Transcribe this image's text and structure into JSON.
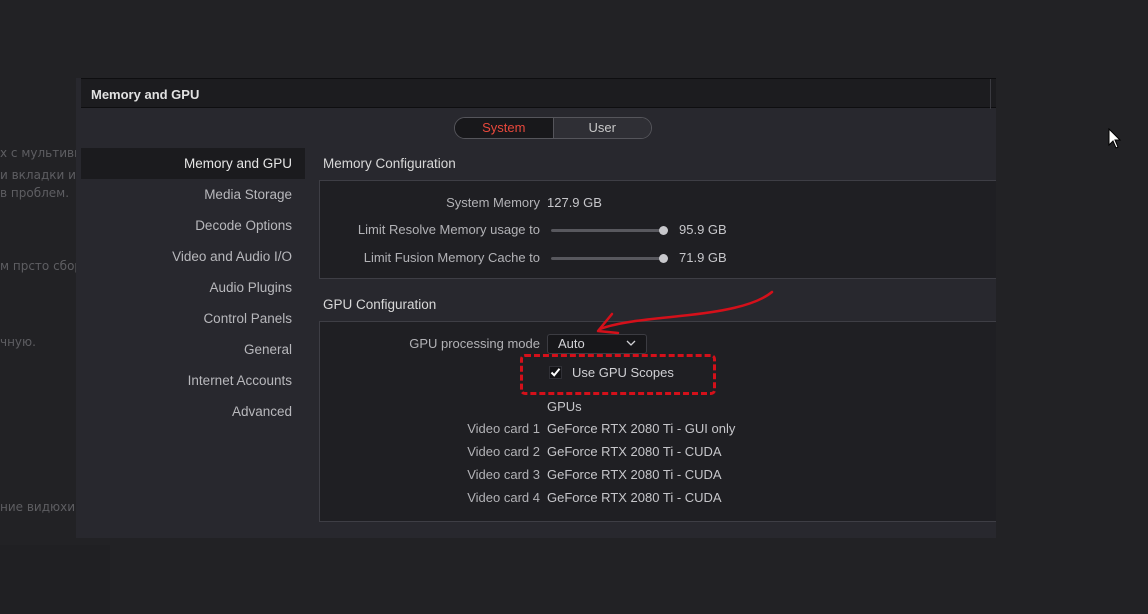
{
  "background": {
    "snippets": [
      "х с мультивк",
      "и вкладки и",
      "в проблем.",
      "м прсто сбор",
      "чную.",
      "ние видюхи д"
    ]
  },
  "dialog": {
    "title": "Memory and GPU",
    "tabs": [
      {
        "label": "System",
        "active": true
      },
      {
        "label": "User",
        "active": false
      }
    ]
  },
  "sidebar": {
    "items": [
      {
        "label": "Memory and GPU",
        "active": true
      },
      {
        "label": "Media Storage"
      },
      {
        "label": "Decode Options"
      },
      {
        "label": "Video and Audio I/O"
      },
      {
        "label": "Audio Plugins"
      },
      {
        "label": "Control Panels"
      },
      {
        "label": "General"
      },
      {
        "label": "Internet Accounts"
      },
      {
        "label": "Advanced"
      }
    ]
  },
  "memory": {
    "section_title": "Memory Configuration",
    "system_memory_label": "System Memory",
    "system_memory_value": "127.9 GB",
    "limit_resolve_label": "Limit Resolve Memory usage to",
    "limit_resolve_value": "95.9 GB",
    "limit_resolve_fraction": 1.0,
    "limit_fusion_label": "Limit Fusion Memory Cache to",
    "limit_fusion_value": "71.9 GB",
    "limit_fusion_fraction": 1.0
  },
  "gpu": {
    "section_title": "GPU Configuration",
    "processing_mode_label": "GPU processing mode",
    "processing_mode_value": "Auto",
    "use_gpu_scopes_label": "Use GPU Scopes",
    "use_gpu_scopes_checked": true,
    "gpus_heading": "GPUs",
    "cards": [
      {
        "label": "Video card 1",
        "value": "GeForce RTX 2080 Ti - GUI only"
      },
      {
        "label": "Video card 2",
        "value": "GeForce RTX 2080 Ti - CUDA"
      },
      {
        "label": "Video card 3",
        "value": "GeForce RTX 2080 Ti - CUDA"
      },
      {
        "label": "Video card 4",
        "value": "GeForce RTX 2080 Ti - CUDA"
      }
    ]
  },
  "colors": {
    "accent_active_tab": "#e8483c",
    "annotation_red": "#d4101a"
  }
}
